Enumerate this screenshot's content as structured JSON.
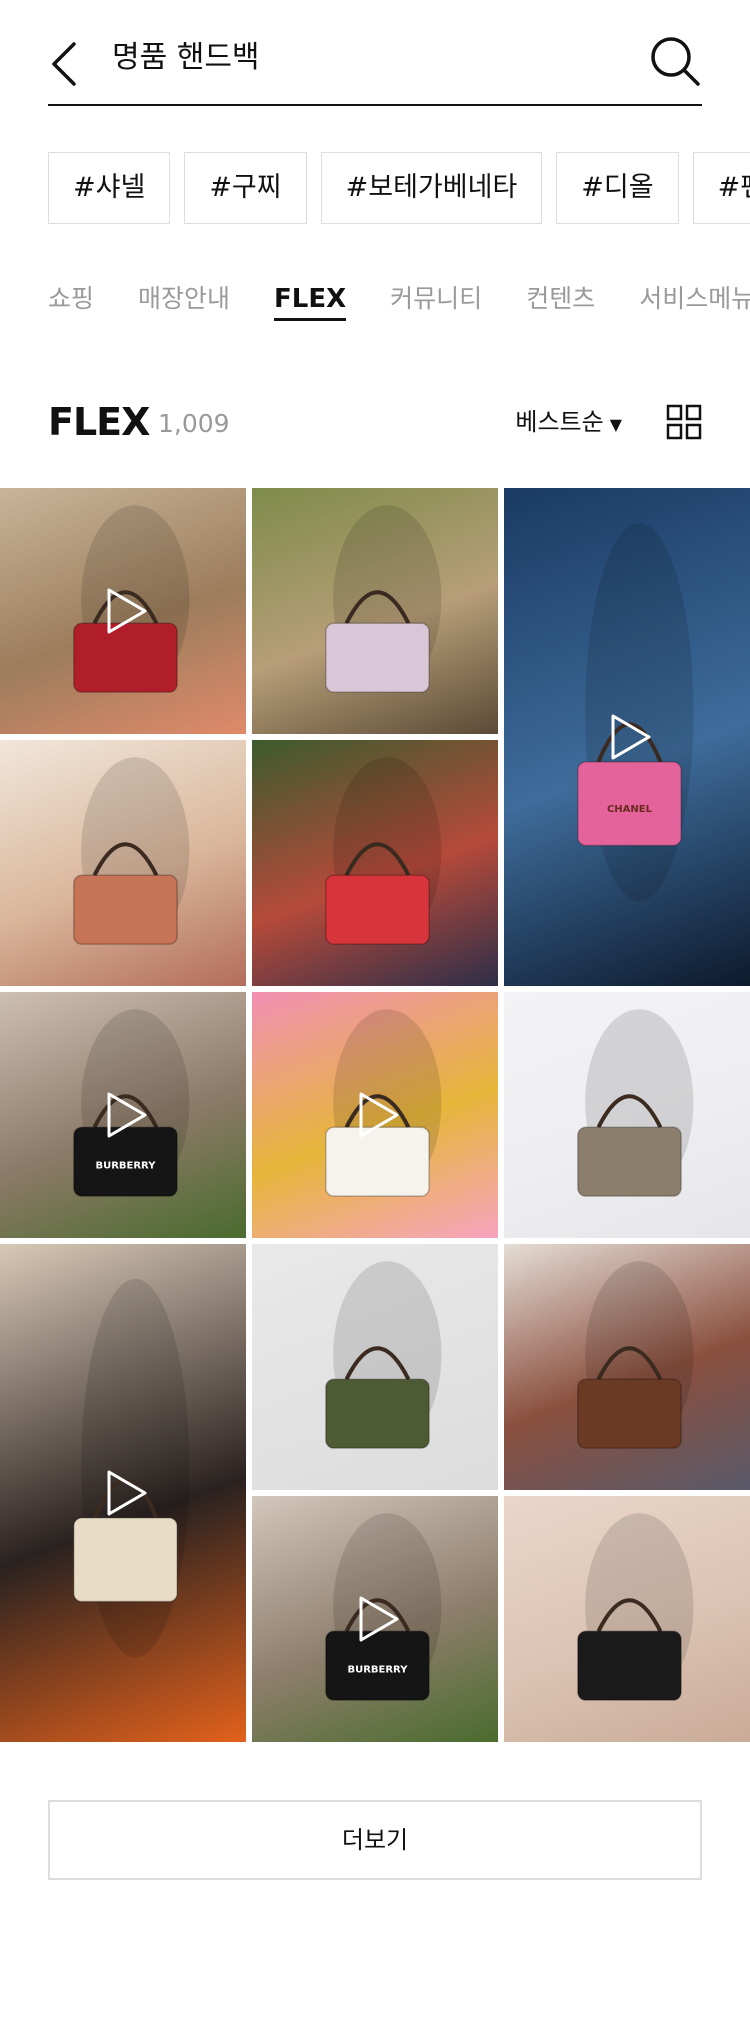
{
  "search": {
    "query": "명품 핸드백"
  },
  "hashtags": [
    "#샤넬",
    "#구찌",
    "#보테가베네타",
    "#디올",
    "#펜디"
  ],
  "tabs": [
    {
      "label": "쇼핑",
      "active": false
    },
    {
      "label": "매장안내",
      "active": false
    },
    {
      "label": "FLEX",
      "active": true
    },
    {
      "label": "커뮤니티",
      "active": false
    },
    {
      "label": "컨텐츠",
      "active": false
    },
    {
      "label": "서비스메뉴",
      "active": false
    }
  ],
  "section": {
    "title": "FLEX",
    "count": "1,009",
    "sort_label": "베스트순",
    "sort_icon": "caret-down-icon",
    "view_icon": "grid-view-icon"
  },
  "feed": {
    "tiles": [
      {
        "name": "feed-tile-1",
        "subject": "couple-desert-fashion",
        "is_video": true,
        "bag_color": "#b01e2a",
        "bg": [
          "#c9b49a",
          "#9c7d5c",
          "#e08a6a"
        ]
      },
      {
        "name": "feed-tile-2",
        "subject": "owl-pastel-bag",
        "is_video": false,
        "bag_color": "#d8c7d6",
        "bg": [
          "#7e8c4a",
          "#b79e78",
          "#5b4a36"
        ]
      },
      {
        "name": "feed-tile-3",
        "subject": "chanel-pink-bag",
        "is_video": true,
        "bag_color": "#e4639a",
        "bg": [
          "#1a3a63",
          "#3e6c9b",
          "#0d1a2d"
        ],
        "bag_text": "CHANEL"
      },
      {
        "name": "feed-tile-4",
        "subject": "woman-olive-bag",
        "is_video": false,
        "bag_color": "#c77355",
        "bg": [
          "#f1e6da",
          "#d9b69b",
          "#b36d5c"
        ]
      },
      {
        "name": "feed-tile-5",
        "subject": "plaid-jacket-red-bag",
        "is_video": false,
        "bag_color": "#d8343c",
        "bg": [
          "#3c5b2e",
          "#b54a3a",
          "#2e2e48"
        ]
      },
      {
        "name": "feed-tile-6",
        "subject": "man-check-tote",
        "is_video": true,
        "bag_color": "#151515",
        "bg": [
          "#cdbfb2",
          "#8c7a68",
          "#4a6b2e"
        ],
        "bag_text": "BURBERRY"
      },
      {
        "name": "feed-tile-7",
        "subject": "trefoil-top-handle",
        "is_video": true,
        "bag_color": "#f6f2ec",
        "bg": [
          "#f28fb4",
          "#e6b63a",
          "#f7a4c0"
        ]
      },
      {
        "name": "feed-tile-8",
        "subject": "gg-camera-bag",
        "is_video": false,
        "bag_color": "#8c7e6c",
        "bg": [
          "#f3f3f5",
          "#eeeef1",
          "#e6e6ea"
        ]
      },
      {
        "name": "feed-tile-9",
        "subject": "woman-flowers-tights",
        "is_video": true,
        "bag_color": "#e8dcc6",
        "bg": [
          "#d8c8b6",
          "#2a2220",
          "#e2611c"
        ]
      },
      {
        "name": "feed-tile-10",
        "subject": "green-cream-bag",
        "is_video": false,
        "bag_color": "#4d5a33",
        "bg": [
          "#e9e9e9",
          "#e2e2e2",
          "#dcdcdc"
        ]
      },
      {
        "name": "feed-tile-11",
        "subject": "woman-brown-bag",
        "is_video": false,
        "bag_color": "#6b3a24",
        "bg": [
          "#e5ddd5",
          "#8a4f3e",
          "#5a5a6a"
        ]
      },
      {
        "name": "feed-tile-12",
        "subject": "check-dress-tote",
        "is_video": true,
        "bag_color": "#151515",
        "bg": [
          "#d2c7bb",
          "#8f7f6d",
          "#4a6b2e"
        ],
        "bag_text": "BURBERRY"
      },
      {
        "name": "feed-tile-13",
        "subject": "black-bucket-bag",
        "is_video": false,
        "bag_color": "#1a1a1a",
        "bg": [
          "#ead7ca",
          "#dcc3b3",
          "#c9ab97"
        ]
      }
    ]
  },
  "more_button": "더보기",
  "icons": {
    "back": "back-arrow-icon",
    "search": "search-icon",
    "play": "play-icon"
  }
}
